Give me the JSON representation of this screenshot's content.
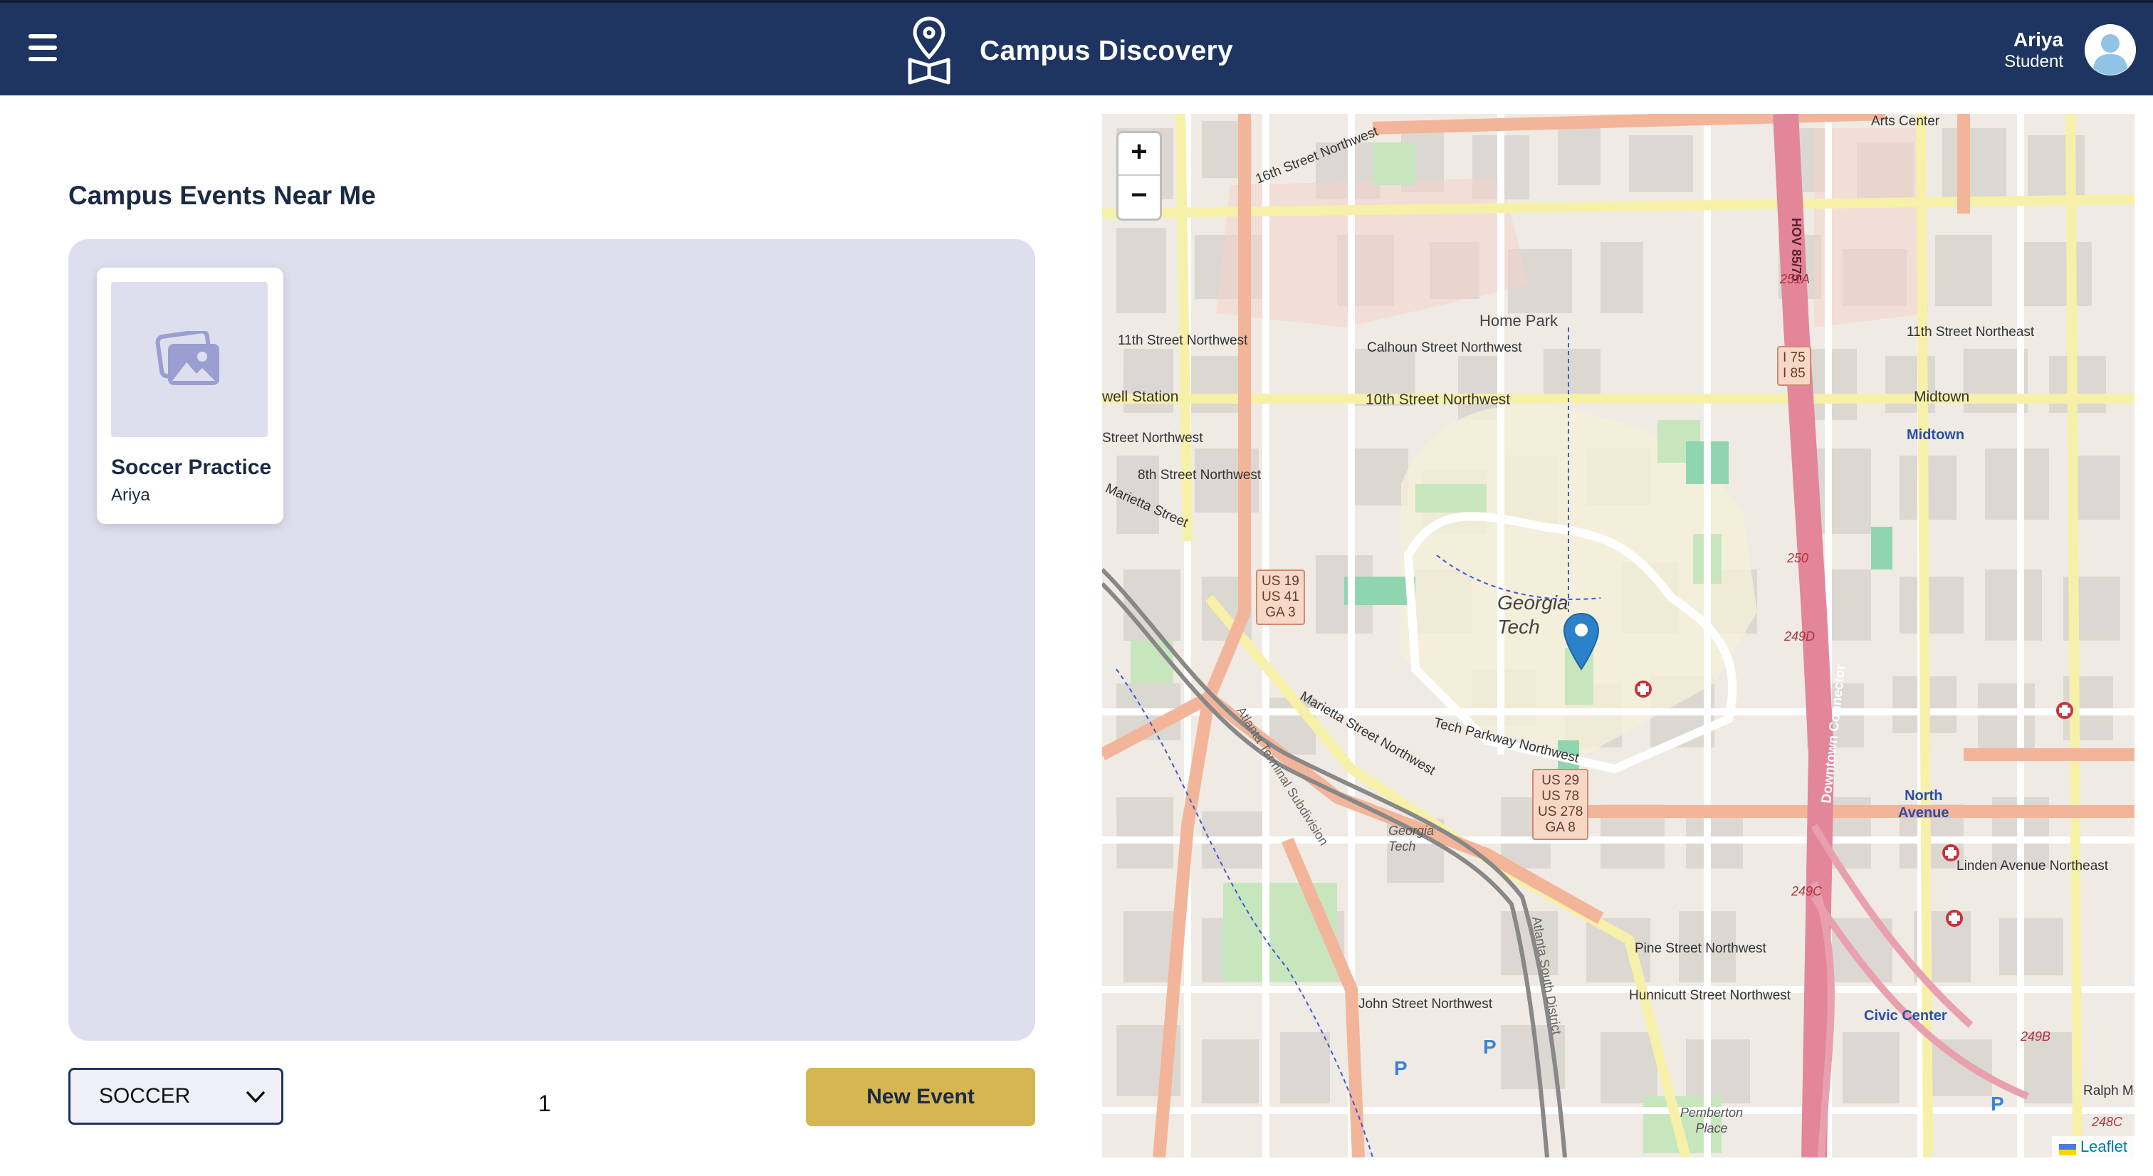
{
  "header": {
    "title": "Campus Discovery",
    "user_name": "Ariya",
    "user_role": "Student"
  },
  "main": {
    "section_title": "Campus Events Near Me",
    "events": [
      {
        "title": "Soccer Practice",
        "owner": "Ariya"
      }
    ],
    "filter": {
      "selected": "SOCCER"
    },
    "page_number": "1",
    "new_event_label": "New Event"
  },
  "map": {
    "zoom_in": "+",
    "zoom_out": "−",
    "attribution": "Leaflet",
    "labels": {
      "street_16th": "16th Street Northwest",
      "street_11th": "11th Street Northwest",
      "street_11th_ne": "11th Street Northeast",
      "street_10th": "10th Street Northwest",
      "street_8th": "8th Street Northwest",
      "home_park": "Home Park",
      "calhoun": "Calhoun Street Northwest",
      "well_station": "well Station",
      "midtown": "Midtown",
      "midtown_station": "Midtown",
      "georgia_tech": "Georgia\nTech",
      "georgia_tech_small": "Georgia\nTech",
      "marietta": "Marietta Street Northwest",
      "tech_parkway": "Tech Parkway Northwest",
      "north_avenue": "North\nAvenue",
      "linden": "Linden Avenue Northeast",
      "pine": "Pine Street Northwest",
      "hunnicutt": "Hunnicutt Street Northwest",
      "john": "John Street Northwest",
      "civic_center": "Civic Center",
      "pemberton": "Pemberton\nPlace",
      "downtown_connector": "Downtown Connector",
      "ralph": "Ralph McGi",
      "arts_center": "Arts Center",
      "us19": "US 19\nUS 41\nGA 3",
      "us29": "US 29\nUS 78\nUS 278\nGA 8",
      "i75": "I 75\nI 85",
      "hov": "HOV 85/75",
      "exit251a": "251A",
      "exit250": "250",
      "exit249d": "249D",
      "exit249c": "249C",
      "exit249b": "249B",
      "exit248c": "248C",
      "marietta_street_label": "Marietta Street",
      "street_left": "Street Northwest",
      "atlanta_terminal": "Atlanta Terminal Subdivision",
      "atlanta_south": "Atlanta South District"
    }
  }
}
